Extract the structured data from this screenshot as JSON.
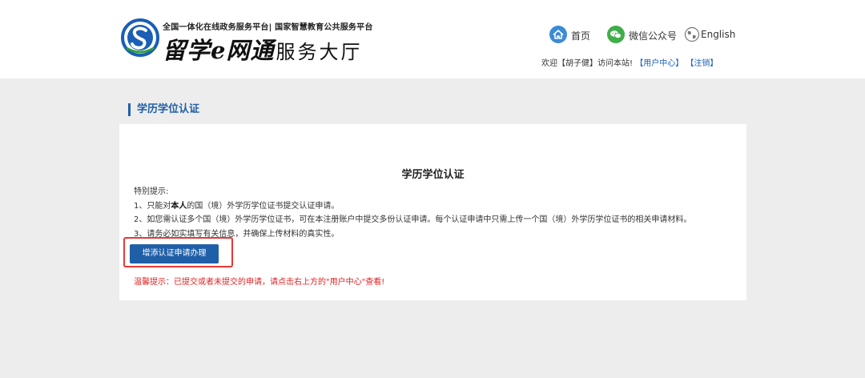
{
  "header": {
    "logo_sub": "全国一体化在线政务服务平台| 国家智慧教育公共服务平台",
    "logo_brand": "留学e网通",
    "logo_hall": "服务大厅",
    "nav": {
      "home_label": "首页",
      "wechat_label": "微信公众号",
      "english_label": "English"
    },
    "welcome": {
      "prefix": "欢迎【胡子健】访问本站!",
      "user_center": "【用户中心】",
      "logout": "【注销】"
    }
  },
  "main": {
    "section_title": "学历学位认证",
    "card_title": "学历学位认证",
    "notice_heading": "特别提示:",
    "notice_1_pre": "1、只能对",
    "notice_1_bold": "本人",
    "notice_1_post": "的国（境）外学历学位证书提交认证申请。",
    "notice_2": "2、如您需认证多个国（境）外学历学位证书，可在本注册账户中提交多份认证申请。每个认证申请中只需上传一个国（境）外学历学位证书的相关申请材料。",
    "notice_3": "3、请务必如实填写有关信息，并确保上传材料的真实性。",
    "apply_button": "增添认证申请办理",
    "warm_tip": "温馨提示：已提交或者未提交的申请，请点击右上方的\"用户中心\"查看!"
  },
  "colors": {
    "accent": "#1f5fa8",
    "warning": "#e02020",
    "highlight_outline": "#e53935",
    "page_bg": "#ededed"
  },
  "icons": {
    "logo": "cscse-logo-icon",
    "home": "home-icon",
    "wechat": "wechat-icon",
    "language": "globe-icon"
  }
}
